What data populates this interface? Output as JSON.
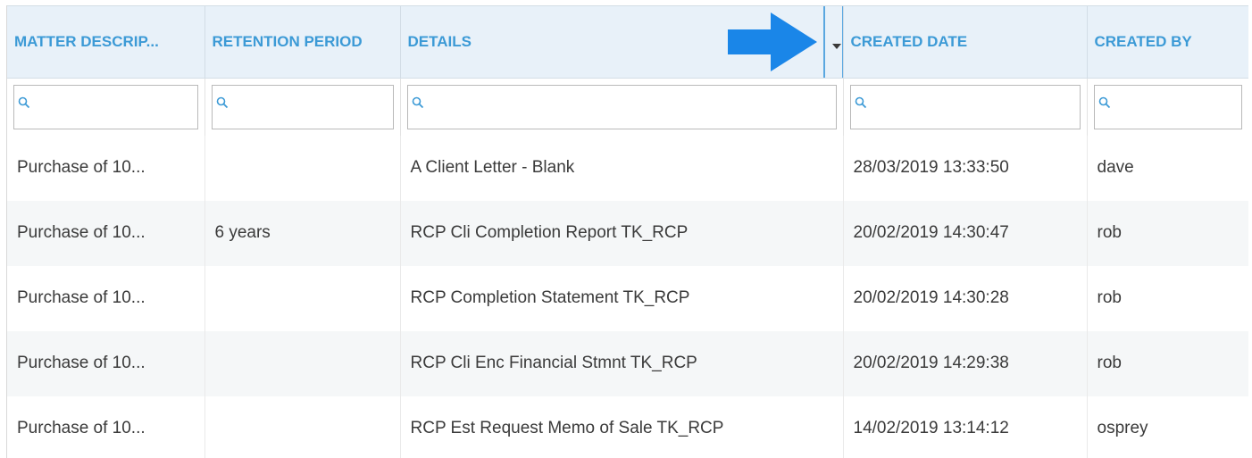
{
  "columns": [
    {
      "key": "matter_description",
      "label": "MATTER DESCRIP..."
    },
    {
      "key": "retention_period",
      "label": "RETENTION PERIOD"
    },
    {
      "key": "details",
      "label": "DETAILS"
    },
    {
      "key": "created_date",
      "label": "CREATED DATE"
    },
    {
      "key": "created_by",
      "label": "CREATED BY"
    }
  ],
  "filters": [
    {
      "placeholder": ""
    },
    {
      "placeholder": ""
    },
    {
      "placeholder": ""
    },
    {
      "placeholder": ""
    },
    {
      "placeholder": ""
    }
  ],
  "rows": [
    {
      "matter_description": "Purchase of 10...",
      "retention_period": "",
      "details": "A Client Letter - Blank",
      "created_date": "28/03/2019 13:33:50",
      "created_by": "dave"
    },
    {
      "matter_description": "Purchase of 10...",
      "retention_period": "6 years",
      "details": "RCP Cli Completion Report TK_RCP",
      "created_date": "20/02/2019 14:30:47",
      "created_by": "rob"
    },
    {
      "matter_description": "Purchase of 10...",
      "retention_period": "",
      "details": "RCP Completion Statement TK_RCP",
      "created_date": "20/02/2019 14:30:28",
      "created_by": "rob"
    },
    {
      "matter_description": "Purchase of 10...",
      "retention_period": "",
      "details": "RCP Cli Enc Financial Stmnt TK_RCP",
      "created_date": "20/02/2019 14:29:38",
      "created_by": "rob"
    },
    {
      "matter_description": "Purchase of 10...",
      "retention_period": "",
      "details": "RCP Est Request Memo of Sale TK_RCP",
      "created_date": "14/02/2019 13:14:12",
      "created_by": "osprey"
    }
  ],
  "icons": {
    "filter": "search-icon",
    "column_menu": "chevron-down-icon",
    "annotation": "arrow-right-icon"
  },
  "colors": {
    "header_text": "#3c9ad6",
    "header_bg": "#e8f1f9",
    "arrow": "#1a86e8",
    "alt_row": "#f5f7f8"
  }
}
